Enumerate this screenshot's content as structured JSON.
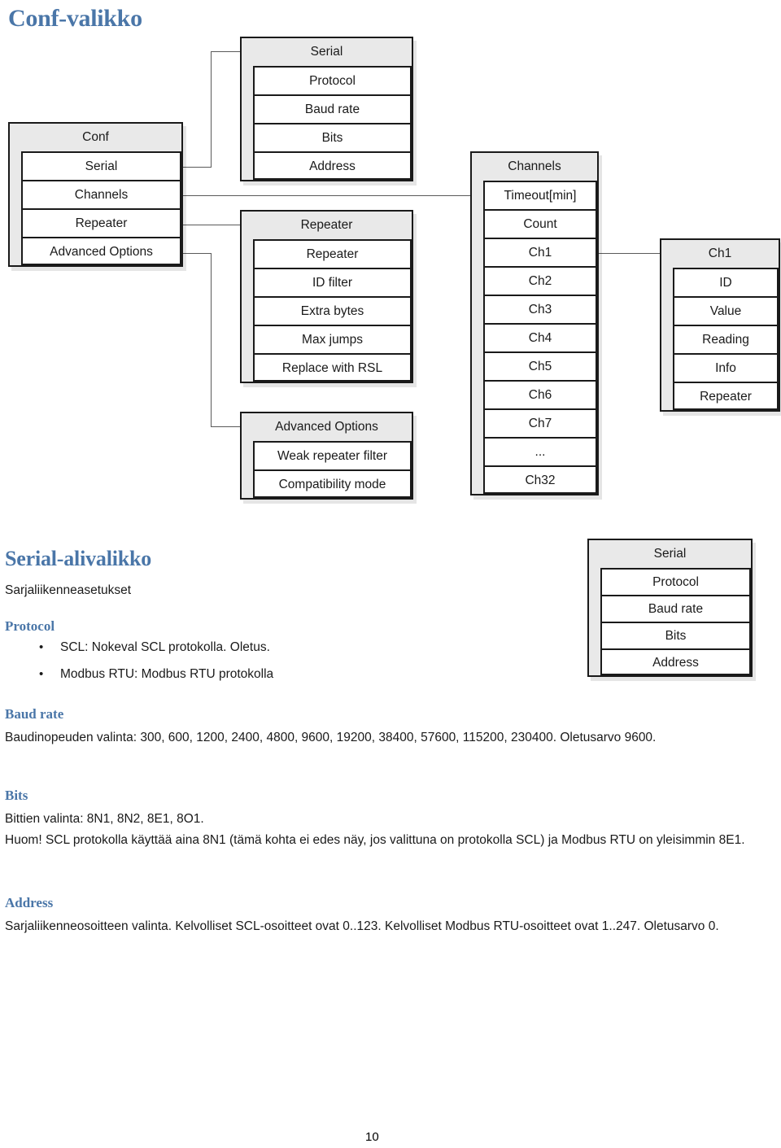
{
  "page": {
    "title": "Conf-valikko",
    "page_number": "10",
    "accent_color": "#4a76a8",
    "box_header_fill": "#e9e9e9",
    "box_border_color": "#1a1a1a"
  },
  "diagram": {
    "name": "conf-menu-tree",
    "boxes": [
      {
        "id": "conf",
        "header": "Conf",
        "rows": [
          "Serial",
          "Channels",
          "Repeater",
          "Advanced Options"
        ]
      },
      {
        "id": "serial",
        "header": "Serial",
        "rows": [
          "Protocol",
          "Baud rate",
          "Bits",
          "Address"
        ]
      },
      {
        "id": "repeater",
        "header": "Repeater",
        "rows": [
          "Repeater",
          "ID filter",
          "Extra bytes",
          "Max jumps",
          "Replace with RSL"
        ]
      },
      {
        "id": "advanced-options",
        "header": "Advanced Options",
        "rows": [
          "Weak repeater filter",
          "Compatibility mode"
        ]
      },
      {
        "id": "channels",
        "header": "Channels",
        "rows": [
          "Timeout[min]",
          "Count",
          "Ch1",
          "Ch2",
          "Ch3",
          "Ch4",
          "Ch5",
          "Ch6",
          "Ch7",
          "...",
          "Ch32"
        ]
      },
      {
        "id": "channel-detail",
        "header": "Ch1",
        "rows": [
          "ID",
          "Value",
          "Reading",
          "Info",
          "Repeater"
        ]
      }
    ]
  },
  "serial_section": {
    "heading": "Serial-alivalikko",
    "subtitle": "Sarjaliikenneasetukset",
    "protocol": {
      "heading": "Protocol",
      "bullets": [
        "SCL: Nokeval SCL protokolla. Oletus.",
        "Modbus RTU: Modbus RTU protokolla"
      ]
    },
    "baud_rate": {
      "heading": "Baud rate",
      "paragraph": "Baudinopeuden valinta: 300, 600, 1200, 2400, 4800, 9600, 19200, 38400, 57600, 115200, 230400. Oletusarvo 9600."
    },
    "bits": {
      "heading": "Bits",
      "paragraph_1": "Bittien valinta: 8N1, 8N2, 8E1, 8O1.",
      "paragraph_2": "Huom! SCL protokolla käyttää aina 8N1 (tämä kohta ei edes näy, jos valittuna on protokolla SCL) ja Modbus RTU on yleisimmin 8E1."
    },
    "address": {
      "heading": "Address",
      "paragraph": "Sarjaliikenneosoitteen valinta. Kelvolliset SCL-osoitteet ovat 0..123. Kelvolliset Modbus RTU-osoitteet ovat 1..247. Oletusarvo 0."
    },
    "side_box": {
      "id": "serial-side",
      "header": "Serial",
      "rows": [
        "Protocol",
        "Baud rate",
        "Bits",
        "Address"
      ]
    }
  }
}
